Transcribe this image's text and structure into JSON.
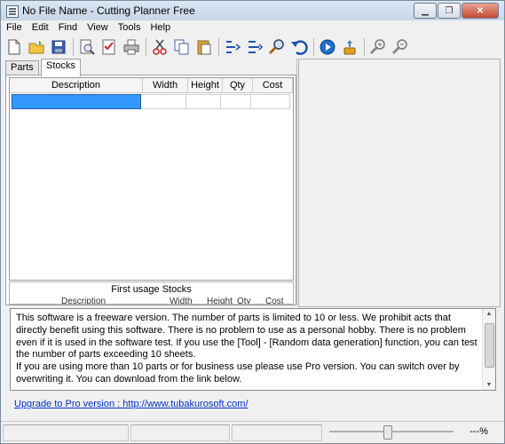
{
  "window": {
    "title": "No File Name - Cutting Planner Free",
    "controls": [
      "minimize",
      "restore",
      "close"
    ]
  },
  "menu": [
    "File",
    "Edit",
    "Find",
    "View",
    "Tools",
    "Help"
  ],
  "toolbar": {
    "icons": [
      "new-file-icon",
      "open-folder-icon",
      "save-icon",
      "print-preview-icon",
      "checklist-icon",
      "printer-icon",
      "cut-icon",
      "copy-icon",
      "paste-icon",
      "align-left-icon",
      "align-right-icon",
      "search-icon",
      "undo-icon",
      "play-icon",
      "calculate-icon",
      "zoom-in-icon",
      "zoom-out-icon"
    ]
  },
  "tabs": [
    {
      "label": "Parts",
      "active": false
    },
    {
      "label": "Stocks",
      "active": true
    }
  ],
  "stocks_table": {
    "columns": [
      "Description",
      "Width",
      "Height",
      "Qty",
      "Cost"
    ],
    "rows": [
      {
        "description": "",
        "width": "",
        "height": "",
        "qty": "",
        "cost": "",
        "selected": true
      }
    ]
  },
  "first_usage": {
    "title": "First usage Stocks",
    "columns": [
      "Description",
      "Width",
      "Height",
      "Qty",
      "Cost"
    ]
  },
  "info_text": "This software is a freeware version. The number of parts is limited to 10 or less. We prohibit acts that directly benefit using this software. There is no problem to use as a personal hobby. There is no problem even if it is used in the software test. If you use the [Tool] - [Random data generation] function, you can test the number of parts exceeding 10 sheets.\nIf you are using more than 10 parts or for business use please use Pro version. You can switch over by overwriting it. You can download from the link below.",
  "upgrade_link": "Upgrade to Pro version : http://www.tubakurosoft.com/",
  "status": {
    "zoom": "---%"
  },
  "colors": {
    "selection": "#3399ff",
    "link": "#0033cc"
  }
}
